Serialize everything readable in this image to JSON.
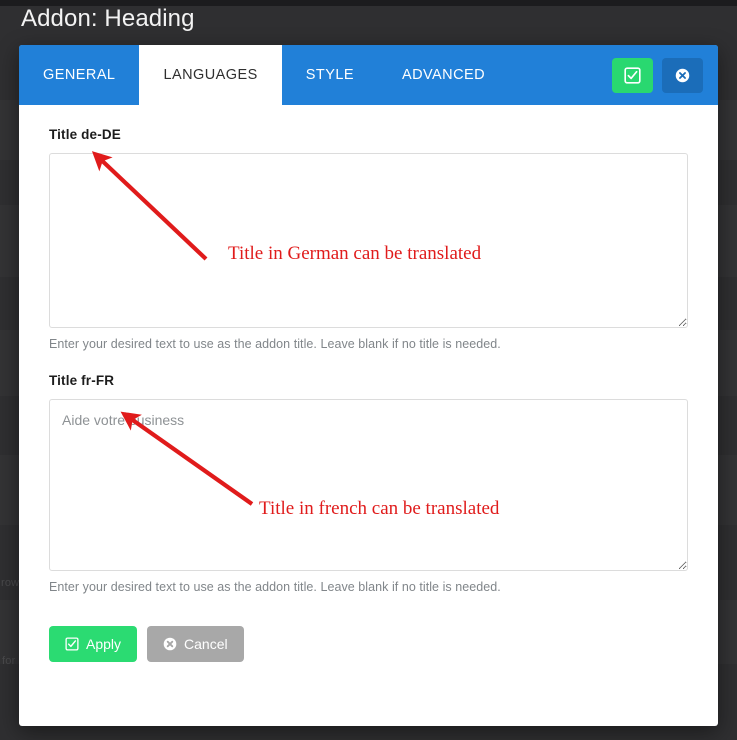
{
  "window": {
    "title": "Addon: Heading"
  },
  "backdrop": {
    "ghost_fragments": [
      "row",
      "for"
    ]
  },
  "tabs": [
    {
      "id": "general",
      "label": "GENERAL",
      "active": false
    },
    {
      "id": "languages",
      "label": "LANGUAGES",
      "active": true
    },
    {
      "id": "style",
      "label": "STYLE",
      "active": false
    },
    {
      "id": "advanced",
      "label": "ADVANCED",
      "active": false
    }
  ],
  "tab_actions": {
    "save": {
      "icon": "check-square-icon",
      "color": "#29d870"
    },
    "close": {
      "icon": "times-circle-icon",
      "color": "#1b6db9"
    }
  },
  "fields": [
    {
      "id": "title-de-DE",
      "label": "Title de-DE",
      "value": "",
      "placeholder": "",
      "help": "Enter your desired text to use as the addon title. Leave blank if no title is needed."
    },
    {
      "id": "title-fr-FR",
      "label": "Title fr-FR",
      "value": "Aide votre business",
      "placeholder": "",
      "help": "Enter your desired text to use as the addon title. Leave blank if no title is needed."
    }
  ],
  "footer": {
    "apply": {
      "label": "Apply",
      "icon": "check-square-icon",
      "color": "#2bdb72"
    },
    "cancel": {
      "label": "Cancel",
      "icon": "times-circle-icon",
      "color": "#a8a8a8"
    }
  },
  "annotations": [
    {
      "id": "anno-german",
      "text": "Title in German can be translated",
      "color": "#e01b1b"
    },
    {
      "id": "anno-french",
      "text": "Title in french can be translated",
      "color": "#e01b1b"
    }
  ]
}
